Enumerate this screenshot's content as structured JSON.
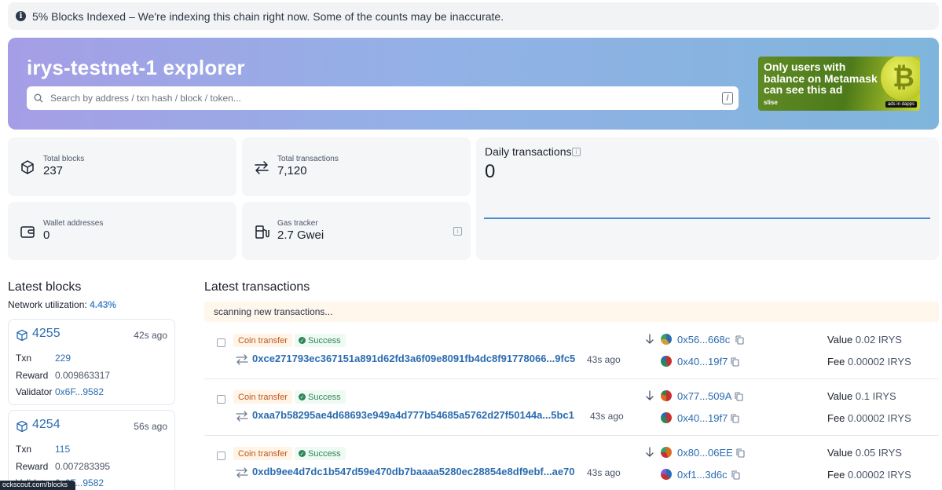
{
  "notice": {
    "text": "5% Blocks Indexed – We're indexing this chain right now. Some of the counts may be inaccurate."
  },
  "hero": {
    "title": "irys-testnet-1 explorer",
    "search_placeholder": "Search by address / txn hash / block / token...",
    "search_shortcut": "/"
  },
  "ad": {
    "line1": "Only users with",
    "line2": "balance on Metamask",
    "line3": "can see this ad",
    "brand": "slise",
    "tag": "ads in dapps"
  },
  "stats": {
    "total_blocks": {
      "label": "Total blocks",
      "value": "237"
    },
    "total_transactions": {
      "label": "Total transactions",
      "value": "7,120"
    },
    "wallet_addresses": {
      "label": "Wallet addresses",
      "value": "0"
    },
    "gas_tracker": {
      "label": "Gas tracker",
      "value": "2.7 Gwei"
    }
  },
  "daily": {
    "title": "Daily transactions",
    "value": "0"
  },
  "latest_blocks": {
    "title": "Latest blocks",
    "utilization_label": "Network utilization:",
    "utilization_value": "4.43%",
    "row_labels": {
      "txn": "Txn",
      "reward": "Reward",
      "validator": "Validator"
    },
    "items": [
      {
        "number": "4255",
        "age": "42s ago",
        "txn": "229",
        "reward": "0.009863317",
        "validator": "0x6F...9582"
      },
      {
        "number": "4254",
        "age": "56s ago",
        "txn": "115",
        "reward": "0.007283395",
        "validator": "0x6F...9582"
      }
    ]
  },
  "latest_transactions": {
    "title": "Latest transactions",
    "scanning": "scanning new transactions...",
    "value_label": "Value",
    "fee_label": "Fee",
    "items": [
      {
        "type": "Coin transfer",
        "status": "Success",
        "hash": "0xce271793ec367151a891d62fd3a6f09e8091fb4dc8f91778066...9fc5",
        "age": "43s ago",
        "from": "0x56...668c",
        "to": "0x40...19f7",
        "value": "0.02 IRYS",
        "fee": "0.00002 IRYS"
      },
      {
        "type": "Coin transfer",
        "status": "Success",
        "hash": "0xaa7b58295ae4d68693e949a4d777b54685a5762d27f50144a...5bc1",
        "age": "43s ago",
        "from": "0x77...509A",
        "to": "0x40...19f7",
        "value": "0.1 IRYS",
        "fee": "0.00002 IRYS"
      },
      {
        "type": "Coin transfer",
        "status": "Success",
        "hash": "0xdb9ee4d7dc1b547d59e470db7baaaa5280ec28854e8df9ebf...ae70",
        "age": "43s ago",
        "from": "0x80...06EE",
        "to": "0xf1...3d6c",
        "value": "0.05 IRYS",
        "fee": "0.00002 IRYS"
      }
    ]
  },
  "status_bar": {
    "url": "ockscout.com/blocks"
  },
  "colors": {
    "accent": "#2b6cb0",
    "success": "#2f855a",
    "warning": "#c05621",
    "hero_start": "#a59ee6",
    "hero_end": "#7fb5dc"
  }
}
